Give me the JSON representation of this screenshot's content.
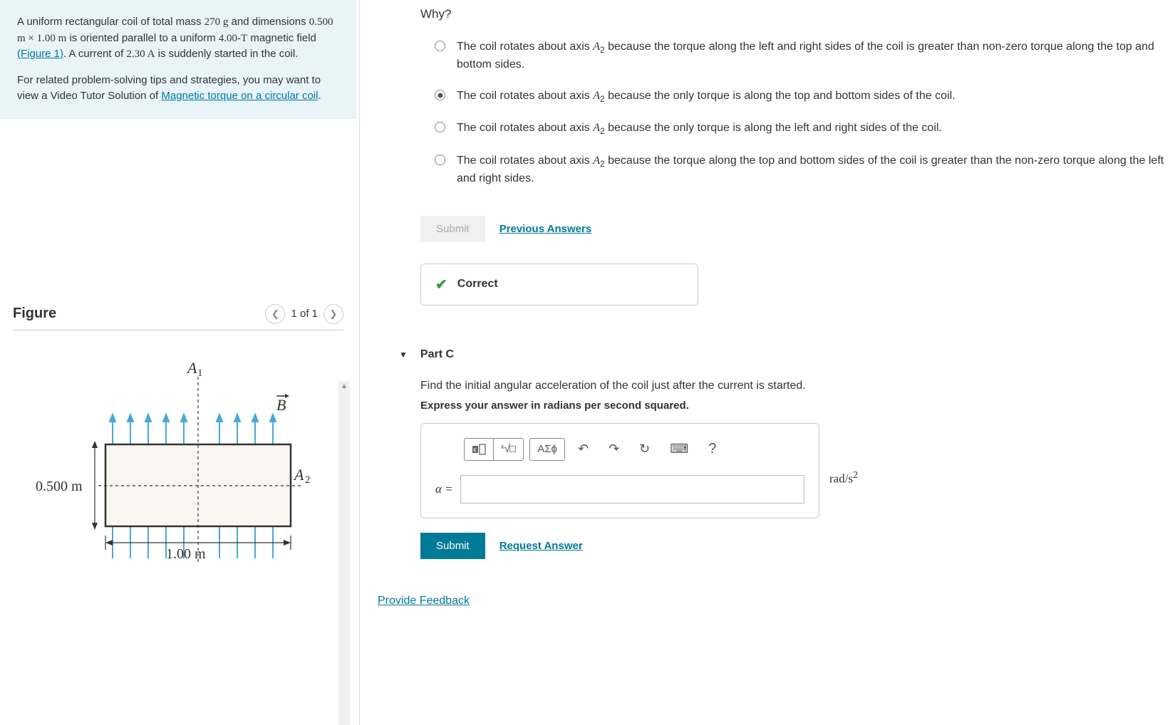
{
  "problem": {
    "paragraph1_prefix": "A uniform rectangular coil of total mass ",
    "mass": "270 g",
    "p1_mid1": " and dimensions ",
    "dims": "0.500 m × 1.00 m",
    "p1_mid2": " is oriented parallel to a uniform ",
    "field": "4.00-T",
    "p1_mid3": " magnetic field ",
    "figlink": "(Figure 1)",
    "p1_mid4": ". A current of ",
    "current": "2.30 A",
    "p1_end": " is suddenly started in the coil.",
    "paragraph2_prefix": "For related problem-solving tips and strategies, you may want to view a Video Tutor Solution of ",
    "videolink": "Magnetic torque on a circular coil",
    "paragraph2_suffix": "."
  },
  "figure": {
    "title": "Figure",
    "count": "1 of 1",
    "label_A1": "A",
    "label_A1_sub": "1",
    "label_A2": "A",
    "label_A2_sub": "2",
    "label_B": "B",
    "dim_h": "0.500 m",
    "dim_w": "1.00 m"
  },
  "why": {
    "heading": "Why?",
    "options": [
      {
        "text_pre": "The coil rotates about axis ",
        "axis": "A",
        "axis_sub": "2",
        "text_post": " because the torque along the left and right sides of the coil is greater than non-zero torque along the top and bottom sides.",
        "selected": false
      },
      {
        "text_pre": "The coil rotates about axis ",
        "axis": "A",
        "axis_sub": "2",
        "text_post": " because the only torque is along the top and bottom sides of the coil.",
        "selected": true
      },
      {
        "text_pre": "The coil rotates about axis ",
        "axis": "A",
        "axis_sub": "2",
        "text_post": " because the only torque is along the left and right sides of the coil.",
        "selected": false
      },
      {
        "text_pre": "The coil rotates about axis ",
        "axis": "A",
        "axis_sub": "2",
        "text_post": " because the torque along the top and bottom sides of the coil is greater than the non-zero torque along the left and right sides.",
        "selected": false
      }
    ],
    "submit_label": "Submit",
    "prev_answers_label": "Previous Answers",
    "feedback": "Correct"
  },
  "partC": {
    "header": "Part C",
    "instruction": "Find the initial angular acceleration of the coil just after the current is started.",
    "subinstruction": "Express your answer in radians per second squared.",
    "var_label": "α =",
    "units_html": "rad/s²",
    "submit_label": "Submit",
    "request_label": "Request Answer",
    "toolbar": {
      "template": "▭",
      "sqrt": "ᵡ√▫",
      "greek": "ΑΣϕ",
      "undo": "↶",
      "redo": "↷",
      "reset": "↻",
      "keyboard": "⌨",
      "help": "?"
    }
  },
  "footer": {
    "provide_feedback": "Provide Feedback"
  }
}
